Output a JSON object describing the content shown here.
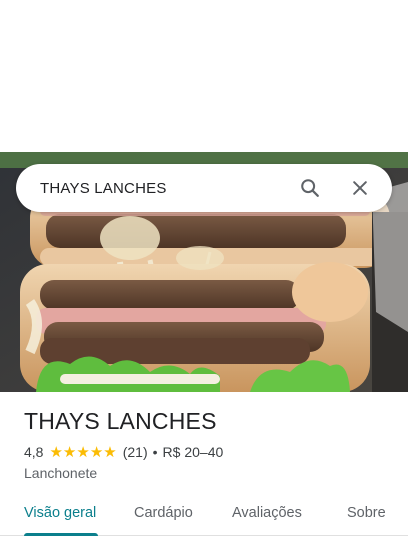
{
  "search": {
    "query": "THAYS LANCHES"
  },
  "icons": {
    "search": "search-icon",
    "close": "close-icon"
  },
  "place": {
    "name": "THAYS LANCHES",
    "rating": "4,8",
    "stars": 5,
    "reviews": "(21)",
    "separator": "•",
    "price": "R$ 20–40",
    "category": "Lanchonete"
  },
  "tabs": [
    {
      "label": "Visão geral",
      "active": true
    },
    {
      "label": "Cardápio",
      "active": false
    },
    {
      "label": "Avaliações",
      "active": false
    },
    {
      "label": "Sobre",
      "active": false
    }
  ],
  "colors": {
    "accent": "#0b7f8c",
    "star": "#fbbc04"
  }
}
